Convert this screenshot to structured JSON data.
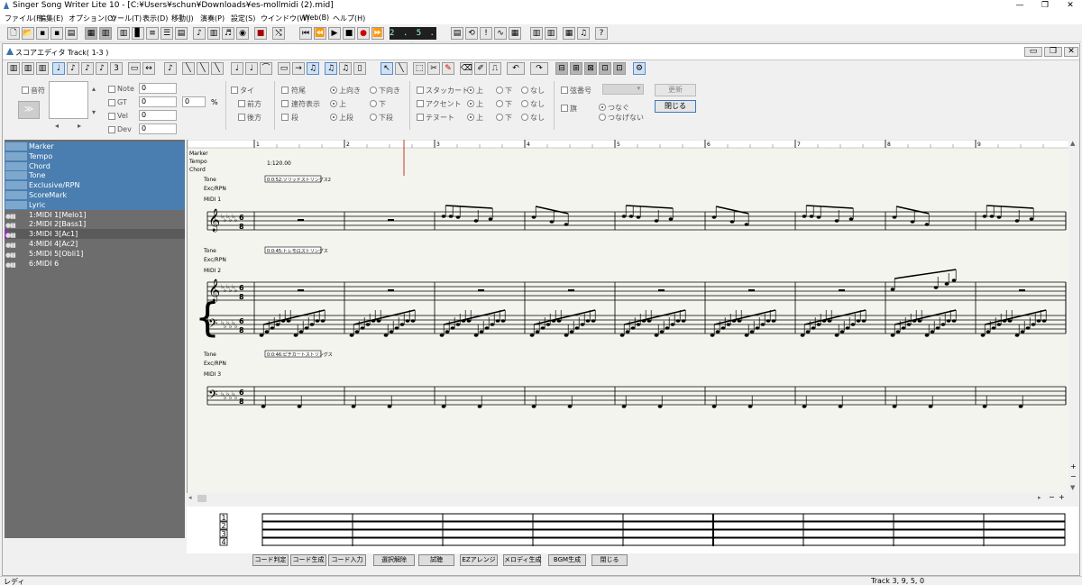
{
  "window": {
    "title": "Singer Song Writer Lite 10 - [C:¥Users¥schun¥Downloads¥es-mollmidi (2).mid]",
    "minimize": "—",
    "maximize": "❐",
    "close": "✕"
  },
  "menu": [
    "ファイル(F)",
    "編集(E)",
    "オプション(O)",
    "ツール(T)",
    "表示(D)",
    "移動(J)",
    "演奏(P)",
    "設定(S)",
    "ウインドウ(W)",
    "Web(B)",
    "ヘルプ(H)"
  ],
  "position_display": "2 . 5 . 0",
  "editor": {
    "title": "スコアエディタ Track( 1-3 )"
  },
  "props": {
    "onpu": "音符",
    "expand": "≫",
    "pager_left": "◂",
    "pager_right": "▸",
    "fields": [
      {
        "label": "Note",
        "value": "0"
      },
      {
        "label": "GT",
        "value": "0"
      },
      {
        "label": "Vel",
        "value": "0"
      },
      {
        "label": "Dev",
        "value": "0"
      }
    ],
    "gt_extra": "0",
    "pct": "%",
    "tie": "タイ",
    "mae": "前方",
    "ato": "後方",
    "fubi": "符尾",
    "renpu": "連符表示",
    "dan": "段",
    "dir_up": "上向き",
    "dir_down": "下向き",
    "ren_up": "上",
    "ren_down": "下",
    "dan_up": "上段",
    "dan_down": "下段",
    "staccato": "スタッカート",
    "accent": "アクセント",
    "tenuto": "テヌート",
    "up": "上",
    "down": "下",
    "none": "なし",
    "string_no": "弦番号",
    "flag": "旗",
    "connect": "つなぐ",
    "not_connect": "つなげない",
    "update": "更新",
    "close": "閉じる"
  },
  "tracks": [
    {
      "label": "Marker"
    },
    {
      "label": "Tempo"
    },
    {
      "label": "Chord"
    },
    {
      "label": "Tone"
    },
    {
      "label": "Exclusive/RPN"
    },
    {
      "label": "ScoreMark"
    },
    {
      "label": "Lyric"
    },
    {
      "label": "1:MIDI 1[Melo1]"
    },
    {
      "label": "2:MIDI 2[Bass1]"
    },
    {
      "label": "3:MIDI 3[Ac1]"
    },
    {
      "label": "4:MIDI 4[Ac2]"
    },
    {
      "label": "5:MIDI 5[Obli1]"
    },
    {
      "label": "6:MIDI 6"
    }
  ],
  "score": {
    "measures": [
      "1",
      "2",
      "3",
      "4",
      "5",
      "6",
      "7",
      "8",
      "9"
    ],
    "marker": "Marker",
    "tempo_label": "Tempo",
    "chord": "Chord",
    "tempo_value": "1:120.00",
    "tone": "Tone",
    "exc": "Exc/RPN",
    "tracks": [
      "MIDI 1",
      "MIDI 2",
      "MIDI 3"
    ],
    "tone_boxes": [
      "0:0:52:ソリッドストリングス2",
      "0:0:45:トレモロストリングス",
      "0:0:46:ピチカートストリングス"
    ]
  },
  "chord_panel": {
    "rows": [
      "1",
      "2",
      "3",
      "4"
    ]
  },
  "chord_buttons": [
    "コード判定",
    "コード生成",
    "コード入力",
    "選択解除",
    "試聴",
    "EZアレンジ",
    "メロディ生成",
    "BGM生成",
    "閉じる"
  ],
  "status": {
    "left": "レディ",
    "right": "Track 3, 9, 5, 0"
  },
  "scroll": {
    "up": "▲",
    "down": "▼",
    "left": "◂",
    "right": "▸",
    "zoom_in": "+",
    "zoom_out": "−"
  },
  "colors": {
    "track_sel": "#4a7eb0",
    "playhead": "#c0392b",
    "lcd_bg": "#1f1f1f"
  }
}
